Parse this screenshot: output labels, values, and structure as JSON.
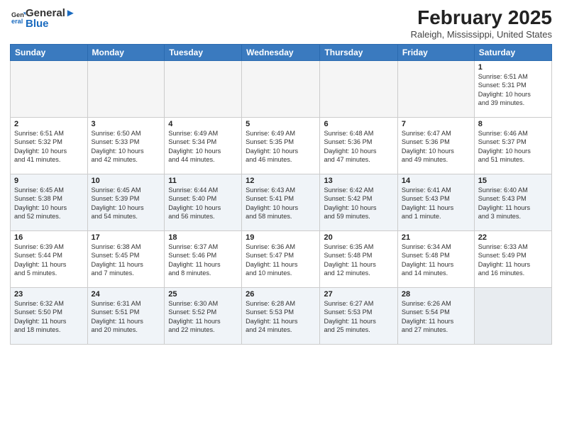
{
  "header": {
    "logo_general": "General",
    "logo_blue": "Blue",
    "main_title": "February 2025",
    "sub_title": "Raleigh, Mississippi, United States"
  },
  "days_of_week": [
    "Sunday",
    "Monday",
    "Tuesday",
    "Wednesday",
    "Thursday",
    "Friday",
    "Saturday"
  ],
  "weeks": [
    {
      "shade": false,
      "days": [
        {
          "num": "",
          "info": ""
        },
        {
          "num": "",
          "info": ""
        },
        {
          "num": "",
          "info": ""
        },
        {
          "num": "",
          "info": ""
        },
        {
          "num": "",
          "info": ""
        },
        {
          "num": "",
          "info": ""
        },
        {
          "num": "1",
          "info": "Sunrise: 6:51 AM\nSunset: 5:31 PM\nDaylight: 10 hours\nand 39 minutes."
        }
      ]
    },
    {
      "shade": false,
      "days": [
        {
          "num": "2",
          "info": "Sunrise: 6:51 AM\nSunset: 5:32 PM\nDaylight: 10 hours\nand 41 minutes."
        },
        {
          "num": "3",
          "info": "Sunrise: 6:50 AM\nSunset: 5:33 PM\nDaylight: 10 hours\nand 42 minutes."
        },
        {
          "num": "4",
          "info": "Sunrise: 6:49 AM\nSunset: 5:34 PM\nDaylight: 10 hours\nand 44 minutes."
        },
        {
          "num": "5",
          "info": "Sunrise: 6:49 AM\nSunset: 5:35 PM\nDaylight: 10 hours\nand 46 minutes."
        },
        {
          "num": "6",
          "info": "Sunrise: 6:48 AM\nSunset: 5:36 PM\nDaylight: 10 hours\nand 47 minutes."
        },
        {
          "num": "7",
          "info": "Sunrise: 6:47 AM\nSunset: 5:36 PM\nDaylight: 10 hours\nand 49 minutes."
        },
        {
          "num": "8",
          "info": "Sunrise: 6:46 AM\nSunset: 5:37 PM\nDaylight: 10 hours\nand 51 minutes."
        }
      ]
    },
    {
      "shade": true,
      "days": [
        {
          "num": "9",
          "info": "Sunrise: 6:45 AM\nSunset: 5:38 PM\nDaylight: 10 hours\nand 52 minutes."
        },
        {
          "num": "10",
          "info": "Sunrise: 6:45 AM\nSunset: 5:39 PM\nDaylight: 10 hours\nand 54 minutes."
        },
        {
          "num": "11",
          "info": "Sunrise: 6:44 AM\nSunset: 5:40 PM\nDaylight: 10 hours\nand 56 minutes."
        },
        {
          "num": "12",
          "info": "Sunrise: 6:43 AM\nSunset: 5:41 PM\nDaylight: 10 hours\nand 58 minutes."
        },
        {
          "num": "13",
          "info": "Sunrise: 6:42 AM\nSunset: 5:42 PM\nDaylight: 10 hours\nand 59 minutes."
        },
        {
          "num": "14",
          "info": "Sunrise: 6:41 AM\nSunset: 5:43 PM\nDaylight: 11 hours\nand 1 minute."
        },
        {
          "num": "15",
          "info": "Sunrise: 6:40 AM\nSunset: 5:43 PM\nDaylight: 11 hours\nand 3 minutes."
        }
      ]
    },
    {
      "shade": false,
      "days": [
        {
          "num": "16",
          "info": "Sunrise: 6:39 AM\nSunset: 5:44 PM\nDaylight: 11 hours\nand 5 minutes."
        },
        {
          "num": "17",
          "info": "Sunrise: 6:38 AM\nSunset: 5:45 PM\nDaylight: 11 hours\nand 7 minutes."
        },
        {
          "num": "18",
          "info": "Sunrise: 6:37 AM\nSunset: 5:46 PM\nDaylight: 11 hours\nand 8 minutes."
        },
        {
          "num": "19",
          "info": "Sunrise: 6:36 AM\nSunset: 5:47 PM\nDaylight: 11 hours\nand 10 minutes."
        },
        {
          "num": "20",
          "info": "Sunrise: 6:35 AM\nSunset: 5:48 PM\nDaylight: 11 hours\nand 12 minutes."
        },
        {
          "num": "21",
          "info": "Sunrise: 6:34 AM\nSunset: 5:48 PM\nDaylight: 11 hours\nand 14 minutes."
        },
        {
          "num": "22",
          "info": "Sunrise: 6:33 AM\nSunset: 5:49 PM\nDaylight: 11 hours\nand 16 minutes."
        }
      ]
    },
    {
      "shade": true,
      "days": [
        {
          "num": "23",
          "info": "Sunrise: 6:32 AM\nSunset: 5:50 PM\nDaylight: 11 hours\nand 18 minutes."
        },
        {
          "num": "24",
          "info": "Sunrise: 6:31 AM\nSunset: 5:51 PM\nDaylight: 11 hours\nand 20 minutes."
        },
        {
          "num": "25",
          "info": "Sunrise: 6:30 AM\nSunset: 5:52 PM\nDaylight: 11 hours\nand 22 minutes."
        },
        {
          "num": "26",
          "info": "Sunrise: 6:28 AM\nSunset: 5:53 PM\nDaylight: 11 hours\nand 24 minutes."
        },
        {
          "num": "27",
          "info": "Sunrise: 6:27 AM\nSunset: 5:53 PM\nDaylight: 11 hours\nand 25 minutes."
        },
        {
          "num": "28",
          "info": "Sunrise: 6:26 AM\nSunset: 5:54 PM\nDaylight: 11 hours\nand 27 minutes."
        },
        {
          "num": "",
          "info": ""
        }
      ]
    }
  ]
}
